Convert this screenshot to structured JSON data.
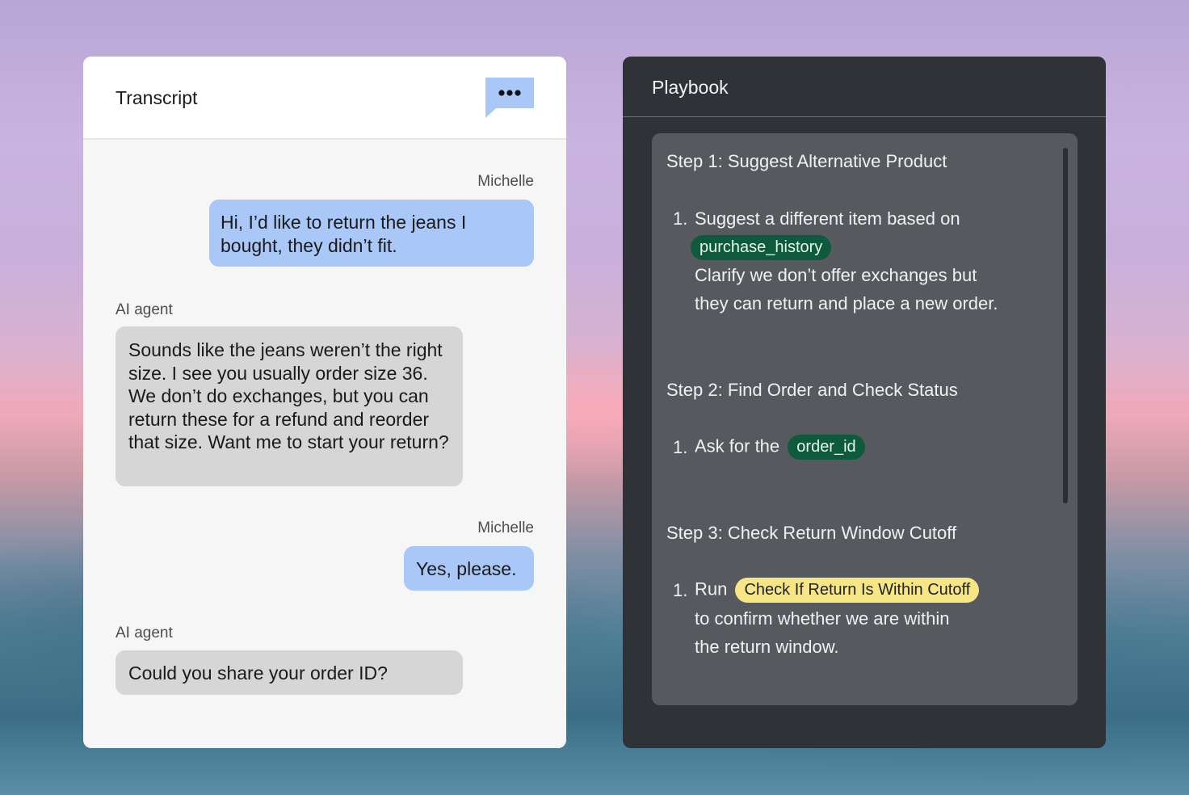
{
  "transcript": {
    "title": "Transcript",
    "messages": [
      {
        "speaker": "Michelle",
        "text": "Hi, I’d like to return the jeans I bought, they didn’t fit."
      },
      {
        "speaker": "AI agent",
        "text": "Sounds like the jeans weren’t the right size. I see you usually order size 36. We don’t do exchanges, but you can return these for a refund and reorder that size. Want me to start your return?"
      },
      {
        "speaker": "Michelle",
        "text": "Yes, please."
      },
      {
        "speaker": "AI agent",
        "text": "Could you share your order ID?"
      }
    ]
  },
  "playbook": {
    "title": "Playbook",
    "steps": [
      {
        "title": "Step 1: Suggest Alternative Product",
        "number": "1.",
        "line1": "Suggest a different item based on",
        "chip": "purchase_history",
        "line2": "Clarify we don’t offer exchanges but",
        "line3": "they can return and place a new order."
      },
      {
        "title": "Step 2: Find Order and Check Status",
        "number": "1.",
        "line1": "Ask for the",
        "chip": "order_id"
      },
      {
        "title": "Step 3: Check Return Window Cutoff",
        "number": "1.",
        "line1": "Run",
        "chip": "Check If Return Is Within Cutoff",
        "line2": "to confirm whether we are within",
        "line3": "the return window."
      }
    ]
  },
  "icons": {
    "chat_menu": "chat-bubble-ellipsis-icon"
  },
  "colors": {
    "user_bubble": "#a9c7f7",
    "agent_bubble": "#d6d6d6",
    "variable_chip": "#0d5a3c",
    "action_chip": "#f7e685",
    "playbook_bg": "#2f3237",
    "playbook_card": "#56595e"
  }
}
